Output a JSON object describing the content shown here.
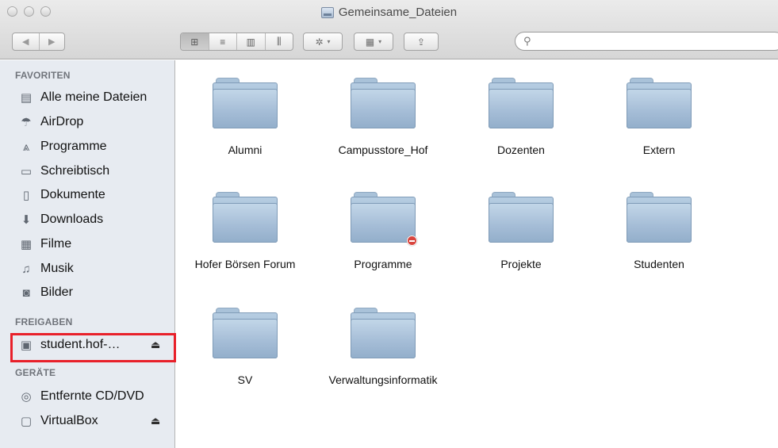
{
  "window": {
    "title": "Gemeinsame_Dateien"
  },
  "toolbar": {
    "back_glyph": "◀",
    "forward_glyph": "▶",
    "view_icon_glyph": "⊞",
    "view_list_glyph": "≡",
    "view_columns_glyph": "▥",
    "view_coverflow_glyph": "⫼",
    "action_glyph": "✲",
    "arrange_glyph": "▦",
    "share_glyph": "⇪",
    "caret_glyph": "▾",
    "search_glyph": "⚲",
    "search_placeholder": ""
  },
  "sidebar": {
    "favorites_header": "FAVORITEN",
    "favorites": [
      {
        "label": "Alle meine Dateien",
        "icon": "all-files-icon",
        "glyph": "▤"
      },
      {
        "label": "AirDrop",
        "icon": "airdrop-icon",
        "glyph": "☂"
      },
      {
        "label": "Programme",
        "icon": "applications-icon",
        "glyph": "⩓"
      },
      {
        "label": "Schreibtisch",
        "icon": "desktop-icon",
        "glyph": "▭"
      },
      {
        "label": "Dokumente",
        "icon": "documents-icon",
        "glyph": "▯"
      },
      {
        "label": "Downloads",
        "icon": "downloads-icon",
        "glyph": "⬇"
      },
      {
        "label": "Filme",
        "icon": "movies-icon",
        "glyph": "▦"
      },
      {
        "label": "Musik",
        "icon": "music-icon",
        "glyph": "♫"
      },
      {
        "label": "Bilder",
        "icon": "pictures-icon",
        "glyph": "◙"
      }
    ],
    "shared_header": "FREIGABEN",
    "shared": [
      {
        "label": "student.hof-…",
        "icon": "server-icon",
        "glyph": "▣",
        "eject": "⏏"
      }
    ],
    "devices_header": "GERÄTE",
    "devices": [
      {
        "label": "Entfernte CD/DVD",
        "icon": "disc-icon",
        "glyph": "◎"
      },
      {
        "label": "VirtualBox",
        "icon": "drive-icon",
        "glyph": "▢",
        "eject": "⏏"
      }
    ]
  },
  "content": {
    "items": [
      {
        "label": "Alumni",
        "locked": false
      },
      {
        "label": "Campusstore_Hof",
        "locked": false
      },
      {
        "label": "Dozenten",
        "locked": false
      },
      {
        "label": "Extern",
        "locked": false
      },
      {
        "label": "Hofer Börsen Forum",
        "locked": false
      },
      {
        "label": "Programme",
        "locked": true
      },
      {
        "label": "Projekte",
        "locked": false
      },
      {
        "label": "Studenten",
        "locked": false
      },
      {
        "label": "SV",
        "locked": false
      },
      {
        "label": "Verwaltungsinformatik",
        "locked": false
      }
    ]
  }
}
